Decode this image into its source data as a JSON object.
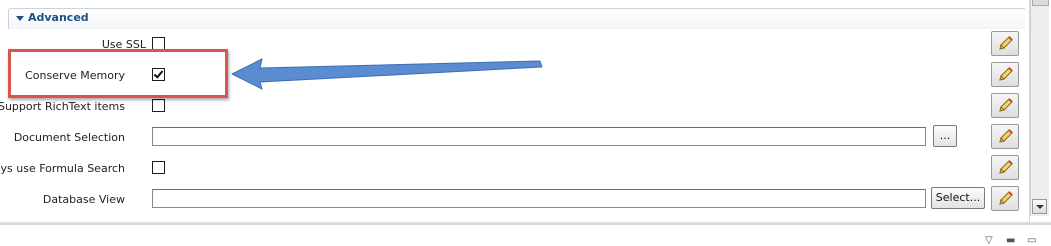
{
  "section": {
    "title": "Advanced"
  },
  "rows": {
    "use_ssl": {
      "label": "Use SSL",
      "checked": false
    },
    "conserve_memory": {
      "label": "Conserve Memory",
      "checked": true
    },
    "support_richtext": {
      "label": "Support RichText items",
      "checked": false
    },
    "document_selection": {
      "label": "Document Selection",
      "value": "",
      "button_label": "..."
    },
    "always_formula_search": {
      "label": "Always use Formula Search",
      "checked": false
    },
    "database_view": {
      "label": "Database View",
      "value": "",
      "button_label": "Select..."
    }
  },
  "annotation": {
    "highlight_color": "#d9534f",
    "arrow_color": "#5b8bd0"
  },
  "icons": {
    "edit": "pencil-icon",
    "collapse": "triangle-down-icon",
    "view_controls": [
      "filter-icon",
      "minimize-icon",
      "maximize-icon"
    ]
  }
}
